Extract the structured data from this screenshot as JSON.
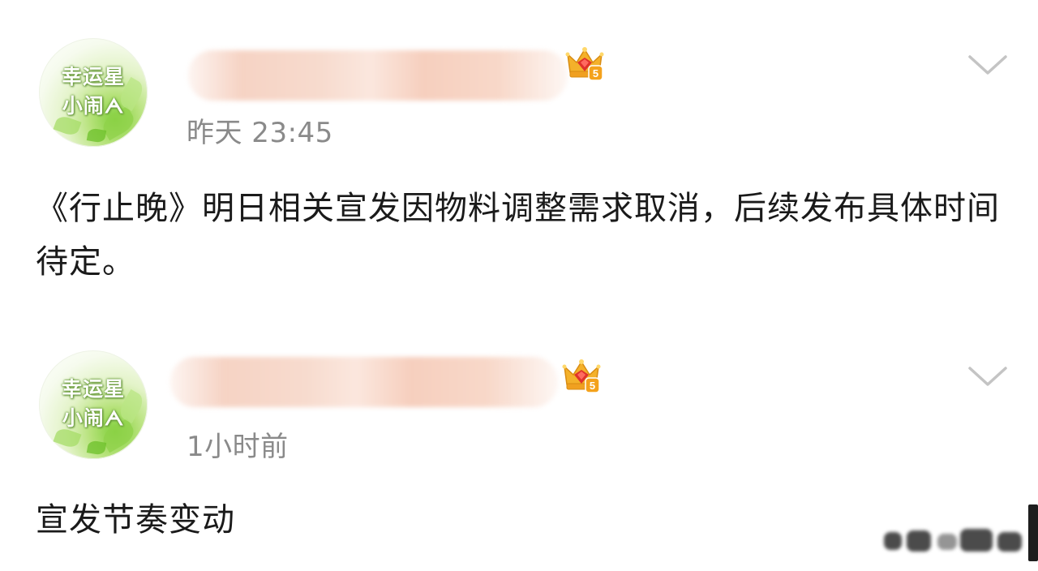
{
  "posts": [
    {
      "avatar": {
        "line1": "幸运星",
        "line2": "小闹ᗅ"
      },
      "timestamp": "昨天 23:45",
      "content": "《行止晚》明日相关宣发因物料调整需求取消，后续发布具体时间待定。",
      "badge_level": "5"
    },
    {
      "avatar": {
        "line1": "幸运星",
        "line2": "小闹ᗅ"
      },
      "timestamp": "1小时前",
      "content": "宣发节奏变动",
      "badge_level": "5"
    }
  ],
  "colors": {
    "text": "#1a1a1a",
    "timestamp": "#8a8a8a",
    "chevron": "#c4c4c4",
    "badge_gold": "#f2a51f",
    "badge_red": "#e0322b"
  },
  "icons": {
    "menu": "chevron-down-icon",
    "badge": "crown-badge-icon"
  }
}
